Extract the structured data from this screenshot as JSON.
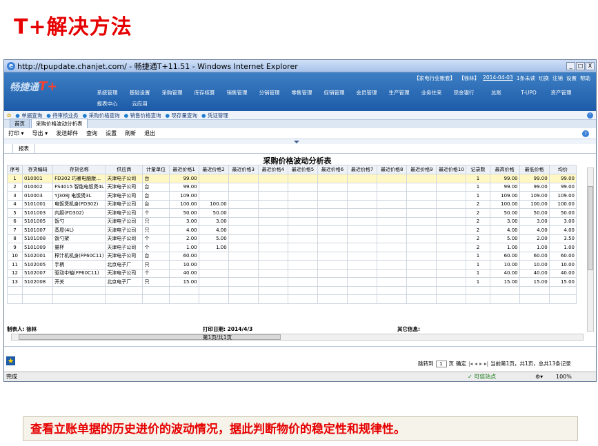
{
  "slide_title": "T+解决方法",
  "window": {
    "title": "http://tpupdate.chanjet.com/ - 畅捷通T+11.51 - Windows Internet Explorer",
    "buttons": [
      "_",
      "□",
      "X"
    ]
  },
  "app": {
    "logo_text": "畅捷通",
    "logo_mark": "T+",
    "userline": {
      "company": "【家电行业账套】",
      "user": "【徐林】",
      "date": "2014-04-03",
      "unread": "1条未读",
      "switch": "切换",
      "logout": "注销",
      "settings": "设置",
      "help": "帮助"
    },
    "menu": [
      "系统管理",
      "基础设置",
      "采购管理",
      "库存核算",
      "销售管理",
      "分销管理",
      "零售管理",
      "促销管理",
      "会员管理",
      "生产管理",
      "业务往来",
      "现金银行",
      "总账",
      "T-UPO",
      "资产管理",
      "报表中心",
      "云应用"
    ]
  },
  "subnav": [
    "单据查询",
    "待审核业务",
    "采购价格查询",
    "销售价格查询",
    "现存量查询",
    "凭证管理"
  ],
  "tabs": [
    "首页",
    "采购价格波动分析表"
  ],
  "toolbar": [
    "打印 ▾",
    "导出 ▾",
    "发送邮件",
    "查询",
    "设置",
    "刷新",
    "退出"
  ],
  "report_tab": "报表",
  "report": {
    "title": "采购价格波动分析表",
    "columns": [
      "序号",
      "存货编码",
      "存货名称",
      "供应商",
      "计量单位",
      "最近价格1",
      "最近价格2",
      "最近价格3",
      "最近价格4",
      "最近价格5",
      "最近价格6",
      "最近价格7",
      "最近价格8",
      "最近价格9",
      "最近价格10",
      "记录数",
      "最高价格",
      "最低价格",
      "均价"
    ],
    "rows": [
      [
        "1",
        "010001",
        "FD302 巧睿电脑版…",
        "天津电子公司",
        "台",
        "99.00",
        "",
        "",
        "",
        "",
        "",
        "",
        "",
        "",
        "",
        "1",
        "99.00",
        "99.00",
        "99.00"
      ],
      [
        "2",
        "010002",
        "FS4015 智能电饭煲4L",
        "天津电子公司",
        "台",
        "99.00",
        "",
        "",
        "",
        "",
        "",
        "",
        "",
        "",
        "",
        "1",
        "99.00",
        "99.00",
        "99.00"
      ],
      [
        "3",
        "010003",
        "YJ308J 电饭煲3L",
        "天津电子公司",
        "台",
        "109.00",
        "",
        "",
        "",
        "",
        "",
        "",
        "",
        "",
        "",
        "1",
        "109.00",
        "109.00",
        "109.00"
      ],
      [
        "4",
        "5101001",
        "电饭煲机身(FD302)",
        "天津电子公司",
        "台",
        "100.00",
        "100.00",
        "",
        "",
        "",
        "",
        "",
        "",
        "",
        "",
        "2",
        "100.00",
        "100.00",
        "100.00"
      ],
      [
        "5",
        "5101003",
        "内胆(FD302)",
        "天津电子公司",
        "个",
        "50.00",
        "50.00",
        "",
        "",
        "",
        "",
        "",
        "",
        "",
        "",
        "2",
        "50.00",
        "50.00",
        "50.00"
      ],
      [
        "6",
        "5101005",
        "饭勺",
        "天津电子公司",
        "只",
        "3.00",
        "3.00",
        "",
        "",
        "",
        "",
        "",
        "",
        "",
        "",
        "2",
        "3.00",
        "3.00",
        "3.00"
      ],
      [
        "7",
        "5101007",
        "蒸屉(4L)",
        "天津电子公司",
        "只",
        "4.00",
        "4.00",
        "",
        "",
        "",
        "",
        "",
        "",
        "",
        "",
        "2",
        "4.00",
        "4.00",
        "4.00"
      ],
      [
        "8",
        "5101008",
        "饭勺架",
        "天津电子公司",
        "个",
        "2.00",
        "5.00",
        "",
        "",
        "",
        "",
        "",
        "",
        "",
        "",
        "2",
        "5.00",
        "2.00",
        "3.50"
      ],
      [
        "9",
        "5101009",
        "量杯",
        "天津电子公司",
        "个",
        "1.00",
        "1.00",
        "",
        "",
        "",
        "",
        "",
        "",
        "",
        "",
        "2",
        "1.00",
        "1.00",
        "1.00"
      ],
      [
        "10",
        "5102001",
        "榨汁机机身(FP60C11)",
        "天津电子公司",
        "台",
        "60.00",
        "",
        "",
        "",
        "",
        "",
        "",
        "",
        "",
        "",
        "1",
        "60.00",
        "60.00",
        "60.00"
      ],
      [
        "11",
        "5102005",
        "手柄",
        "北京电子厂",
        "只",
        "10.00",
        "",
        "",
        "",
        "",
        "",
        "",
        "",
        "",
        "",
        "1",
        "10.00",
        "10.00",
        "10.00"
      ],
      [
        "12",
        "5102007",
        "驱动中轴(FP60C11)",
        "天津电子公司",
        "个",
        "40.00",
        "",
        "",
        "",
        "",
        "",
        "",
        "",
        "",
        "",
        "1",
        "40.00",
        "40.00",
        "40.00"
      ],
      [
        "13",
        "5102008",
        "开关",
        "北京电子厂",
        "只",
        "15.00",
        "",
        "",
        "",
        "",
        "",
        "",
        "",
        "",
        "",
        "1",
        "15.00",
        "15.00",
        "15.00"
      ]
    ]
  },
  "footer": {
    "maker": "制表人: 徐林",
    "print_date": "打印日期: 2014/4/3",
    "page_info": "第1页/共1页",
    "other": "其它信息:"
  },
  "pager": {
    "jump_label": "跳转到",
    "page": "1",
    "page_unit": "页",
    "confirm": "确定",
    "status": "当前第1页，共1页，总共13条记录"
  },
  "statusbar": {
    "left": "完成",
    "trusted": "✓ 可信站点",
    "zoom": "100%"
  },
  "caption": "查看立账单据的历史进价的波动情况，据此判断物价的稳定性和规律性。"
}
